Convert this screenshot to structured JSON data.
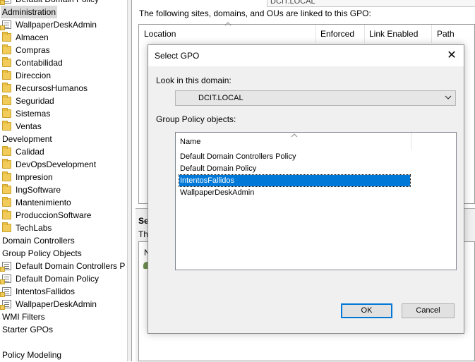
{
  "tree": {
    "items": [
      {
        "label": "Default Domain Policy",
        "icon": "gpo-link-icon"
      },
      {
        "label": "Administration",
        "icon": "none",
        "selected": true
      },
      {
        "label": "WallpaperDeskAdmin",
        "icon": "gpo-link-icon"
      },
      {
        "label": "Almacen",
        "icon": "folder-icon"
      },
      {
        "label": "Compras",
        "icon": "folder-icon"
      },
      {
        "label": "Contabilidad",
        "icon": "folder-icon"
      },
      {
        "label": "Direccion",
        "icon": "folder-icon"
      },
      {
        "label": "RecursosHumanos",
        "icon": "folder-icon"
      },
      {
        "label": "Seguridad",
        "icon": "folder-icon"
      },
      {
        "label": "Sistemas",
        "icon": "folder-icon"
      },
      {
        "label": "Ventas",
        "icon": "folder-icon"
      },
      {
        "label": "Development",
        "icon": "none"
      },
      {
        "label": "Calidad",
        "icon": "folder-icon"
      },
      {
        "label": "DevOpsDevelopment",
        "icon": "folder-icon"
      },
      {
        "label": "Impresion",
        "icon": "folder-icon"
      },
      {
        "label": "IngSoftware",
        "icon": "folder-icon"
      },
      {
        "label": "Mantenimiento",
        "icon": "folder-icon"
      },
      {
        "label": "ProduccionSoftware",
        "icon": "folder-icon"
      },
      {
        "label": "TechLabs",
        "icon": "folder-icon"
      },
      {
        "label": "Domain Controllers",
        "icon": "none"
      },
      {
        "label": "Group Policy Objects",
        "icon": "none"
      },
      {
        "label": "Default Domain Controllers P",
        "icon": "gpo-icon"
      },
      {
        "label": "Default Domain Policy",
        "icon": "gpo-icon"
      },
      {
        "label": "IntentosFallidos",
        "icon": "gpo-icon"
      },
      {
        "label": "WallpaperDeskAdmin",
        "icon": "gpo-icon"
      },
      {
        "label": "WMI Filters",
        "icon": "none"
      },
      {
        "label": "Starter GPOs",
        "icon": "none"
      },
      {
        "label": "Policy Modeling",
        "icon": "none"
      }
    ]
  },
  "right_panel": {
    "domain_box": "DCIT.LOCAL",
    "links_text": "The following sites, domains, and OUs are linked to this GPO:",
    "columns": [
      "Location",
      "Enforced",
      "Link Enabled",
      "Path"
    ],
    "security_title": "Se",
    "security_text": "The",
    "security_col": "N"
  },
  "dialog": {
    "title": "Select GPO",
    "close_glyph": "✕",
    "lookin_label": "Look in this domain:",
    "domain_value": "DCIT.LOCAL",
    "gpo_label": "Group Policy objects:",
    "list_header": "Name",
    "gpos": [
      "Default Domain Controllers Policy",
      "Default Domain Policy",
      "IntentosFallidos",
      "WallpaperDeskAdmin"
    ],
    "selected_gpo": "IntentosFallidos",
    "ok_label": "OK",
    "cancel_label": "Cancel"
  },
  "colors": {
    "selection": "#0078d7",
    "tree_selected": "#d9d9d9",
    "folder": "#f2cc5a"
  }
}
